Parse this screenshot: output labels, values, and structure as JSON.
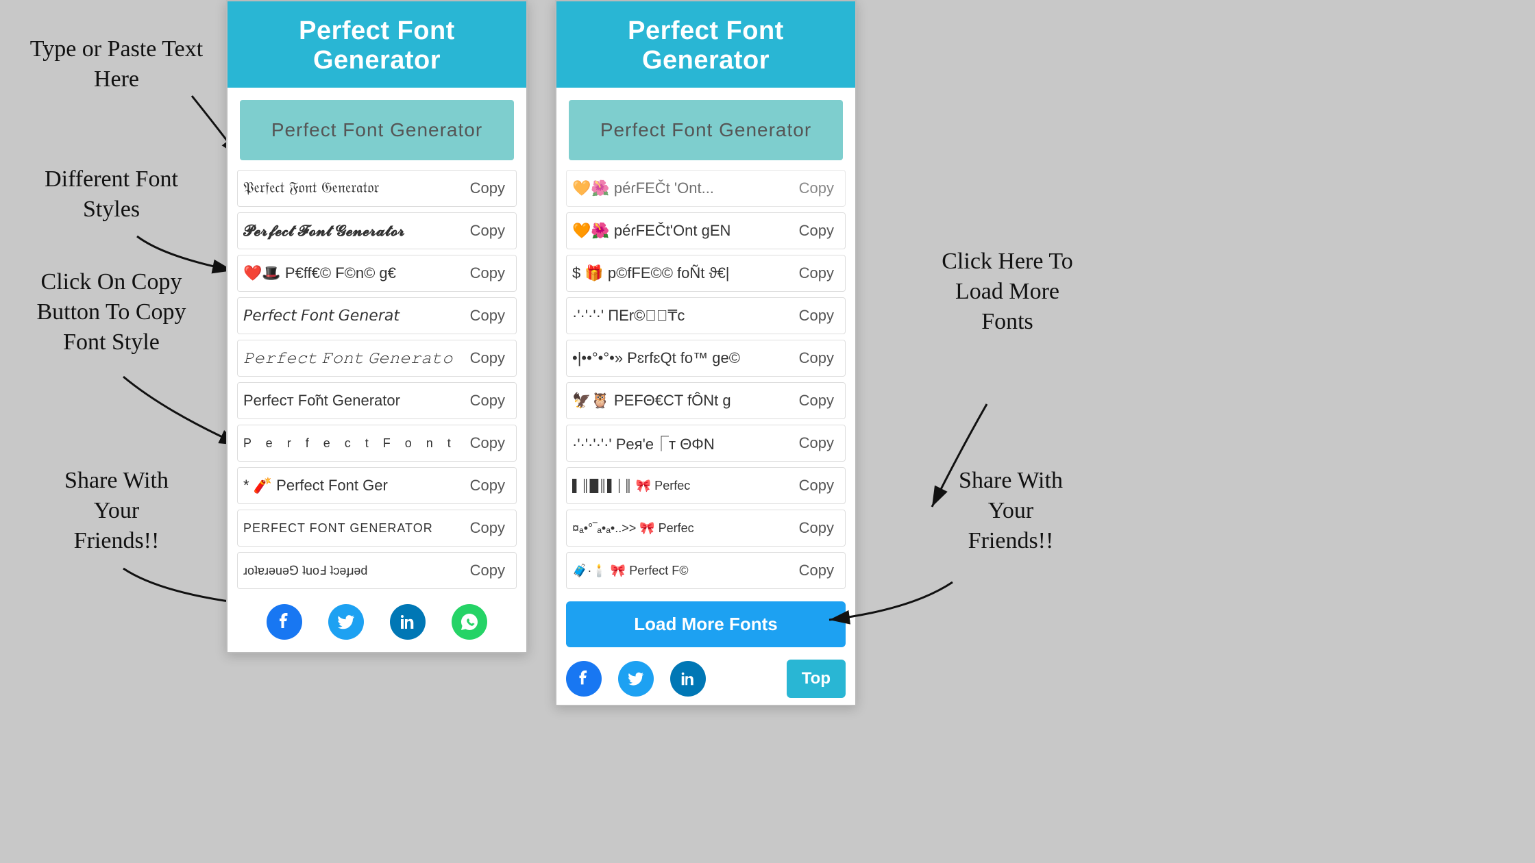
{
  "app": {
    "title": "Perfect Font Generator",
    "input_placeholder": "Perfect Font Generator",
    "input_text": "Perfect Font Generator"
  },
  "annotations": {
    "type_paste": "Type or Paste Text\nHere",
    "different_fonts": "Different Font\nStyles",
    "click_copy": "Click On Copy\nButton To Copy\nFont Style",
    "share": "Share With\nYour\nFriends!!",
    "load_more_label": "Click Here To\nLoad More\nFonts",
    "share2": "Share With\nYour\nFriends!!"
  },
  "panel1": {
    "header": "Perfect Font Generator",
    "input": "Perfect Font Generator",
    "fonts": [
      {
        "text": "𝔓𝔢𝔯𝔣𝔢𝔠𝔱 𝔉𝔬𝔫𝔱 𝔊𝔢𝔫𝔢𝔯𝔞𝔱𝔬𝔯",
        "copy": "Copy",
        "style": ""
      },
      {
        "text": "𝓟𝓮𝓻𝓯𝓮𝓬𝓽 𝓕𝓸𝓷𝓽 𝓖𝓮𝓷𝓮𝓻𝓪𝓽𝓸𝓻",
        "copy": "Copy",
        "style": ""
      },
      {
        "text": "❤️🎩 P€ff€© F©n© g€",
        "copy": "Copy",
        "style": ""
      },
      {
        "text": "𝘗𝘦𝘳𝘧𝘦𝘤𝘵 𝘍𝘰𝘯𝘵 𝘎𝘦𝘯𝘦𝘳𝘢𝘵",
        "copy": "Copy",
        "style": ""
      },
      {
        "text": "𝙿𝚎𝚛𝚏𝚎𝚌𝚝 𝙵𝚘𝚗𝚝 𝙶𝚎𝚗𝚎𝚛𝚊𝚝𝚘",
        "copy": "Copy",
        "style": ""
      },
      {
        "text": "Ρеrfеcт Fо̃nt  Generator",
        "copy": "Copy",
        "style": ""
      },
      {
        "text": "P e r f e c t  F o n t",
        "copy": "Copy",
        "style": "spaced"
      },
      {
        "text": "* 🧨 Perfect Fᴏnt Ger",
        "copy": "Copy",
        "style": ""
      },
      {
        "text": "PERFECT FONT GENERATOR",
        "copy": "Copy",
        "style": "uppercase"
      },
      {
        "text": "ɹoʇɐɹǝuǝ⅁ ʇuoℲ ʇɔǝɟɹǝd",
        "copy": "Copy",
        "style": ""
      }
    ],
    "social": {
      "facebook": "f",
      "twitter": "t",
      "linkedin": "in",
      "whatsapp": "w"
    }
  },
  "panel2": {
    "header": "Perfect Font Generator",
    "input": "Perfect Font Generator",
    "fonts": [
      {
        "text": "🧡🌺 péɾFEČt'Ont gEN",
        "copy": "Copy"
      },
      {
        "text": "$ 🎁 p©fFE©© foÑt ϑ€|",
        "copy": "Copy"
      },
      {
        "text": "·'·'·'·'  ΠEr©⑦ᷮ₸c",
        "copy": "Copy"
      },
      {
        "text": "•|••°•°•» PɛrfɛQt fo™ ge©",
        "copy": "Copy"
      },
      {
        "text": "🦅🦉 ΡΕFΘ€CT fÔNt g",
        "copy": "Copy"
      },
      {
        "text": "·'·'·'·'·' Pея'е⎾т ΘΦΝ",
        "copy": "Copy"
      },
      {
        "text": "▌║█║▌│║ 🎀 Perfec",
        "copy": "Copy"
      },
      {
        "text": "¤ₐ•°‾ₐ•ₐ•..>> 🎀  Perfec",
        "copy": "Copy"
      },
      {
        "text": "🧳·🕯️ 🎀 Perfect F©",
        "copy": "Copy"
      }
    ],
    "load_more": "Load More Fonts",
    "top": "Top",
    "social": {
      "facebook": "f",
      "twitter": "t",
      "linkedin": "in"
    }
  }
}
